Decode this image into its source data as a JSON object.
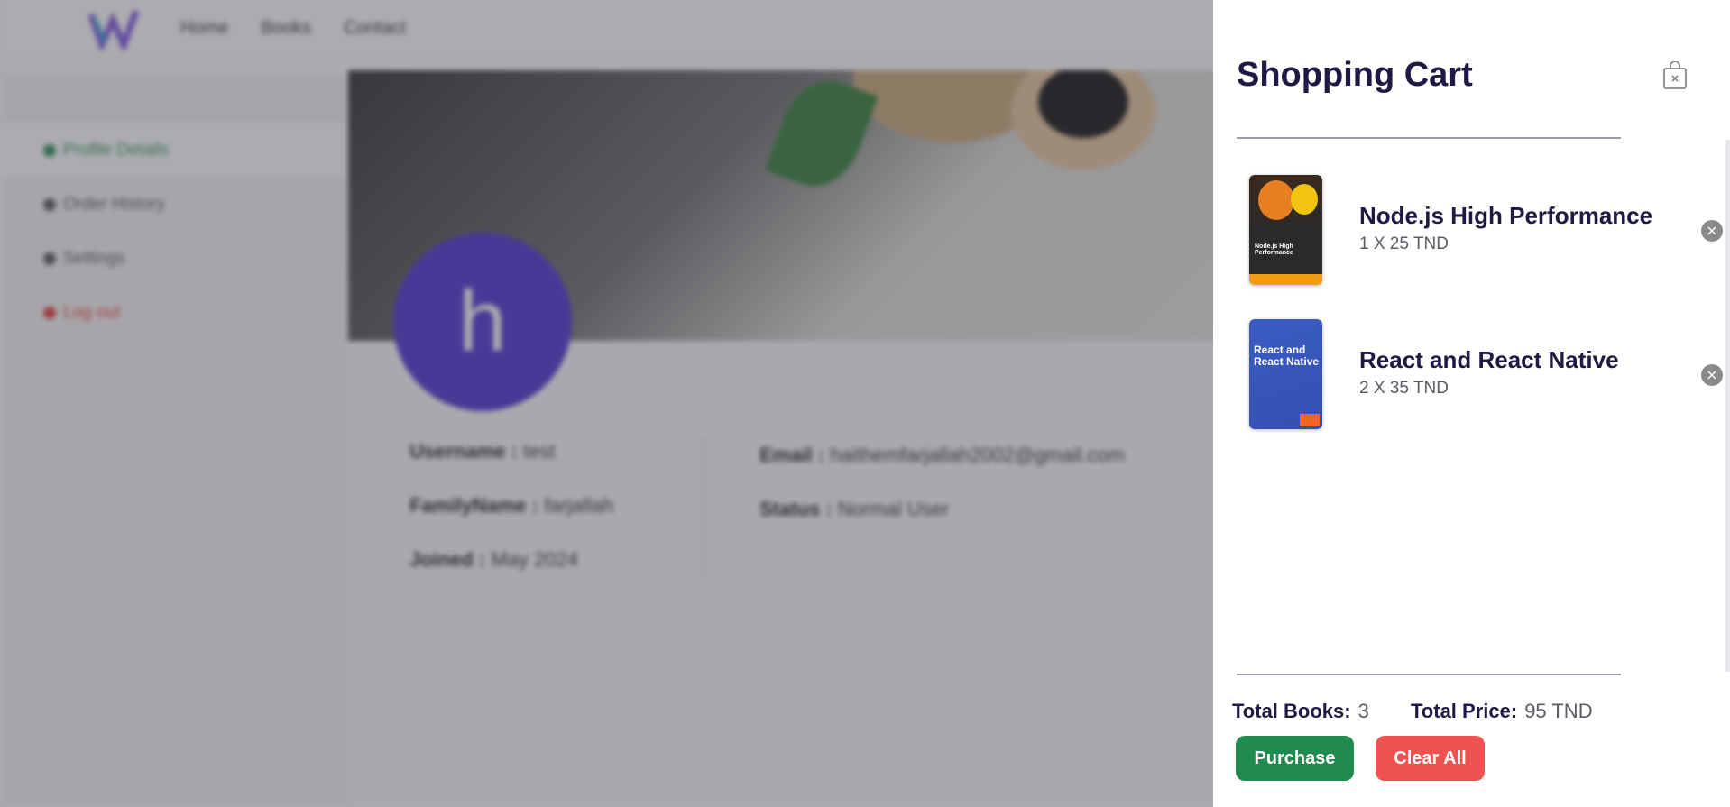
{
  "navbar": {
    "links": [
      "Home",
      "Books",
      "Contact"
    ]
  },
  "sidebar": {
    "items": [
      {
        "label": "Profile Details"
      },
      {
        "label": "Order History"
      },
      {
        "label": "Settings"
      },
      {
        "label": "Log out"
      }
    ]
  },
  "profile": {
    "avatar_letter": "h",
    "username_label": "Username :",
    "username": "test",
    "family_label": "FamilyName :",
    "family": "farjallah",
    "joined_label": "Joined :",
    "joined": "May 2024",
    "email_label": "Email :",
    "email": "haithemfarjallah2002@gmail.com",
    "status_label": "Status :",
    "status": "Normal User"
  },
  "cart": {
    "title": "Shopping Cart",
    "items": [
      {
        "title": "Node.js High Performance",
        "qty": "1 X 25 TND",
        "cover_text": "Node.js High Performance"
      },
      {
        "title": "React and React Native",
        "qty": "2 X 35 TND",
        "cover_text": "React and React Native"
      }
    ],
    "total_books_label": "Total Books:",
    "total_books": "3",
    "total_price_label": "Total Price:",
    "total_price": "95 TND",
    "purchase_label": "Purchase",
    "clear_label": "Clear All"
  },
  "colors": {
    "primary_text": "#1f1a45",
    "purchase": "#218a4e",
    "clear": "#ef5350",
    "avatar": "#4a2fd0"
  }
}
